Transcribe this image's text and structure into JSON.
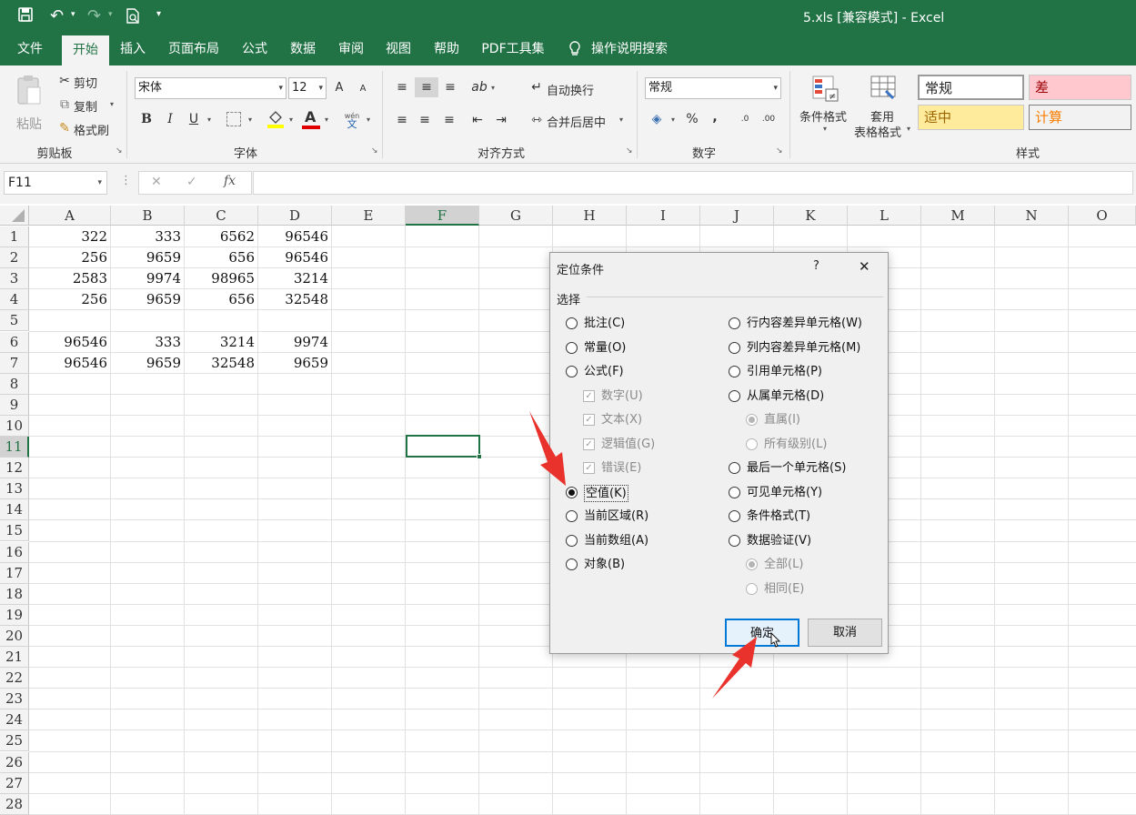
{
  "titlebar": {
    "title": "5.xls  [兼容模式]  -  Excel",
    "icons": [
      "save-icon",
      "undo-icon",
      "redo-icon",
      "print-preview-icon",
      "customize-qat-icon"
    ]
  },
  "tabs": [
    "文件",
    "开始",
    "插入",
    "页面布局",
    "公式",
    "数据",
    "审阅",
    "视图",
    "帮助",
    "PDF工具集",
    "操作说明搜索"
  ],
  "active_tab": "开始",
  "ribbon": {
    "clipboard": {
      "paste": "粘贴",
      "cut": "剪切",
      "copy": "复制",
      "format_painter": "格式刷",
      "label": "剪贴板"
    },
    "font": {
      "name": "宋体",
      "size": "12",
      "bold": "B",
      "italic": "I",
      "underline": "U",
      "font_color_glyph": "A",
      "wen_glyph": "wén",
      "wen_glyph2": "文",
      "grow": "A",
      "shrink": "A",
      "label": "字体"
    },
    "alignment": {
      "wrap": "自动换行",
      "merge": "合并后居中",
      "label": "对齐方式"
    },
    "number": {
      "format": "常规",
      "percent": "%",
      "comma": ",",
      "inc_decimal": ".0",
      "dec_decimal": ".00",
      "label": "数字"
    },
    "styles": {
      "conditional": "条件格式",
      "table_format_1": "套用",
      "table_format_2": "表格格式",
      "normal": "常规",
      "bad": "差",
      "neutral": "适中",
      "calc": "计算",
      "label": "样式"
    }
  },
  "formula_bar": {
    "name_box": "F11",
    "fx": "fx",
    "formula": ""
  },
  "columns": [
    "A",
    "B",
    "C",
    "D",
    "E",
    "F",
    "G",
    "H",
    "I",
    "J",
    "K",
    "L",
    "M",
    "N",
    "O"
  ],
  "rows": [
    "1",
    "2",
    "3",
    "4",
    "5",
    "6",
    "7",
    "8",
    "9",
    "10",
    "11",
    "12",
    "13",
    "14",
    "15",
    "16",
    "17",
    "18",
    "19",
    "20",
    "21",
    "22",
    "23",
    "24",
    "25",
    "26",
    "27",
    "28"
  ],
  "cells": [
    [
      "322",
      "333",
      "6562",
      "96546"
    ],
    [
      "256",
      "9659",
      "656",
      "96546"
    ],
    [
      "2583",
      "9974",
      "98965",
      "3214"
    ],
    [
      "256",
      "9659",
      "656",
      "32548"
    ],
    [
      "",
      "",
      "",
      ""
    ],
    [
      "96546",
      "333",
      "3214",
      "9974"
    ],
    [
      "96546",
      "9659",
      "32548",
      "9659"
    ]
  ],
  "selected_cell": "F11",
  "dialog": {
    "title": "定位条件",
    "help": "?",
    "close": "✕",
    "section": "选择",
    "left_options": [
      {
        "label": "批注(C)",
        "kind": "radio",
        "checked": false,
        "disabled": false
      },
      {
        "label": "常量(O)",
        "kind": "radio",
        "checked": false,
        "disabled": false
      },
      {
        "label": "公式(F)",
        "kind": "radio",
        "checked": false,
        "disabled": false
      },
      {
        "label": "数字(U)",
        "kind": "check",
        "checked": true,
        "disabled": true
      },
      {
        "label": "文本(X)",
        "kind": "check",
        "checked": true,
        "disabled": true
      },
      {
        "label": "逻辑值(G)",
        "kind": "check",
        "checked": true,
        "disabled": true
      },
      {
        "label": "错误(E)",
        "kind": "check",
        "checked": true,
        "disabled": true
      },
      {
        "label": "空值(K)",
        "kind": "radio",
        "checked": true,
        "disabled": false
      },
      {
        "label": "当前区域(R)",
        "kind": "radio",
        "checked": false,
        "disabled": false
      },
      {
        "label": "当前数组(A)",
        "kind": "radio",
        "checked": false,
        "disabled": false
      },
      {
        "label": "对象(B)",
        "kind": "radio",
        "checked": false,
        "disabled": false
      }
    ],
    "right_options": [
      {
        "label": "行内容差异单元格(W)",
        "kind": "radio",
        "checked": false,
        "disabled": false
      },
      {
        "label": "列内容差异单元格(M)",
        "kind": "radio",
        "checked": false,
        "disabled": false
      },
      {
        "label": "引用单元格(P)",
        "kind": "radio",
        "checked": false,
        "disabled": false
      },
      {
        "label": "从属单元格(D)",
        "kind": "radio",
        "checked": false,
        "disabled": false
      },
      {
        "label": "直属(I)",
        "kind": "radio",
        "checked": true,
        "disabled": true
      },
      {
        "label": "所有级别(L)",
        "kind": "radio",
        "checked": false,
        "disabled": true
      },
      {
        "label": "最后一个单元格(S)",
        "kind": "radio",
        "checked": false,
        "disabled": false
      },
      {
        "label": "可见单元格(Y)",
        "kind": "radio",
        "checked": false,
        "disabled": false
      },
      {
        "label": "条件格式(T)",
        "kind": "radio",
        "checked": false,
        "disabled": false
      },
      {
        "label": "数据验证(V)",
        "kind": "radio",
        "checked": false,
        "disabled": false
      },
      {
        "label": "全部(L)",
        "kind": "radio",
        "checked": true,
        "disabled": true
      },
      {
        "label": "相同(E)",
        "kind": "radio",
        "checked": false,
        "disabled": true
      }
    ],
    "ok": "确定",
    "cancel": "取消"
  },
  "colors": {
    "brand": "#217346",
    "selection": "#217346",
    "annotation_arrow": "#e8322b",
    "bad_bg": "#ffc7ce",
    "bad_fg": "#9c0006",
    "neutral_bg": "#ffeb9c",
    "neutral_fg": "#9c6500",
    "calc_fg": "#fa7d00"
  }
}
